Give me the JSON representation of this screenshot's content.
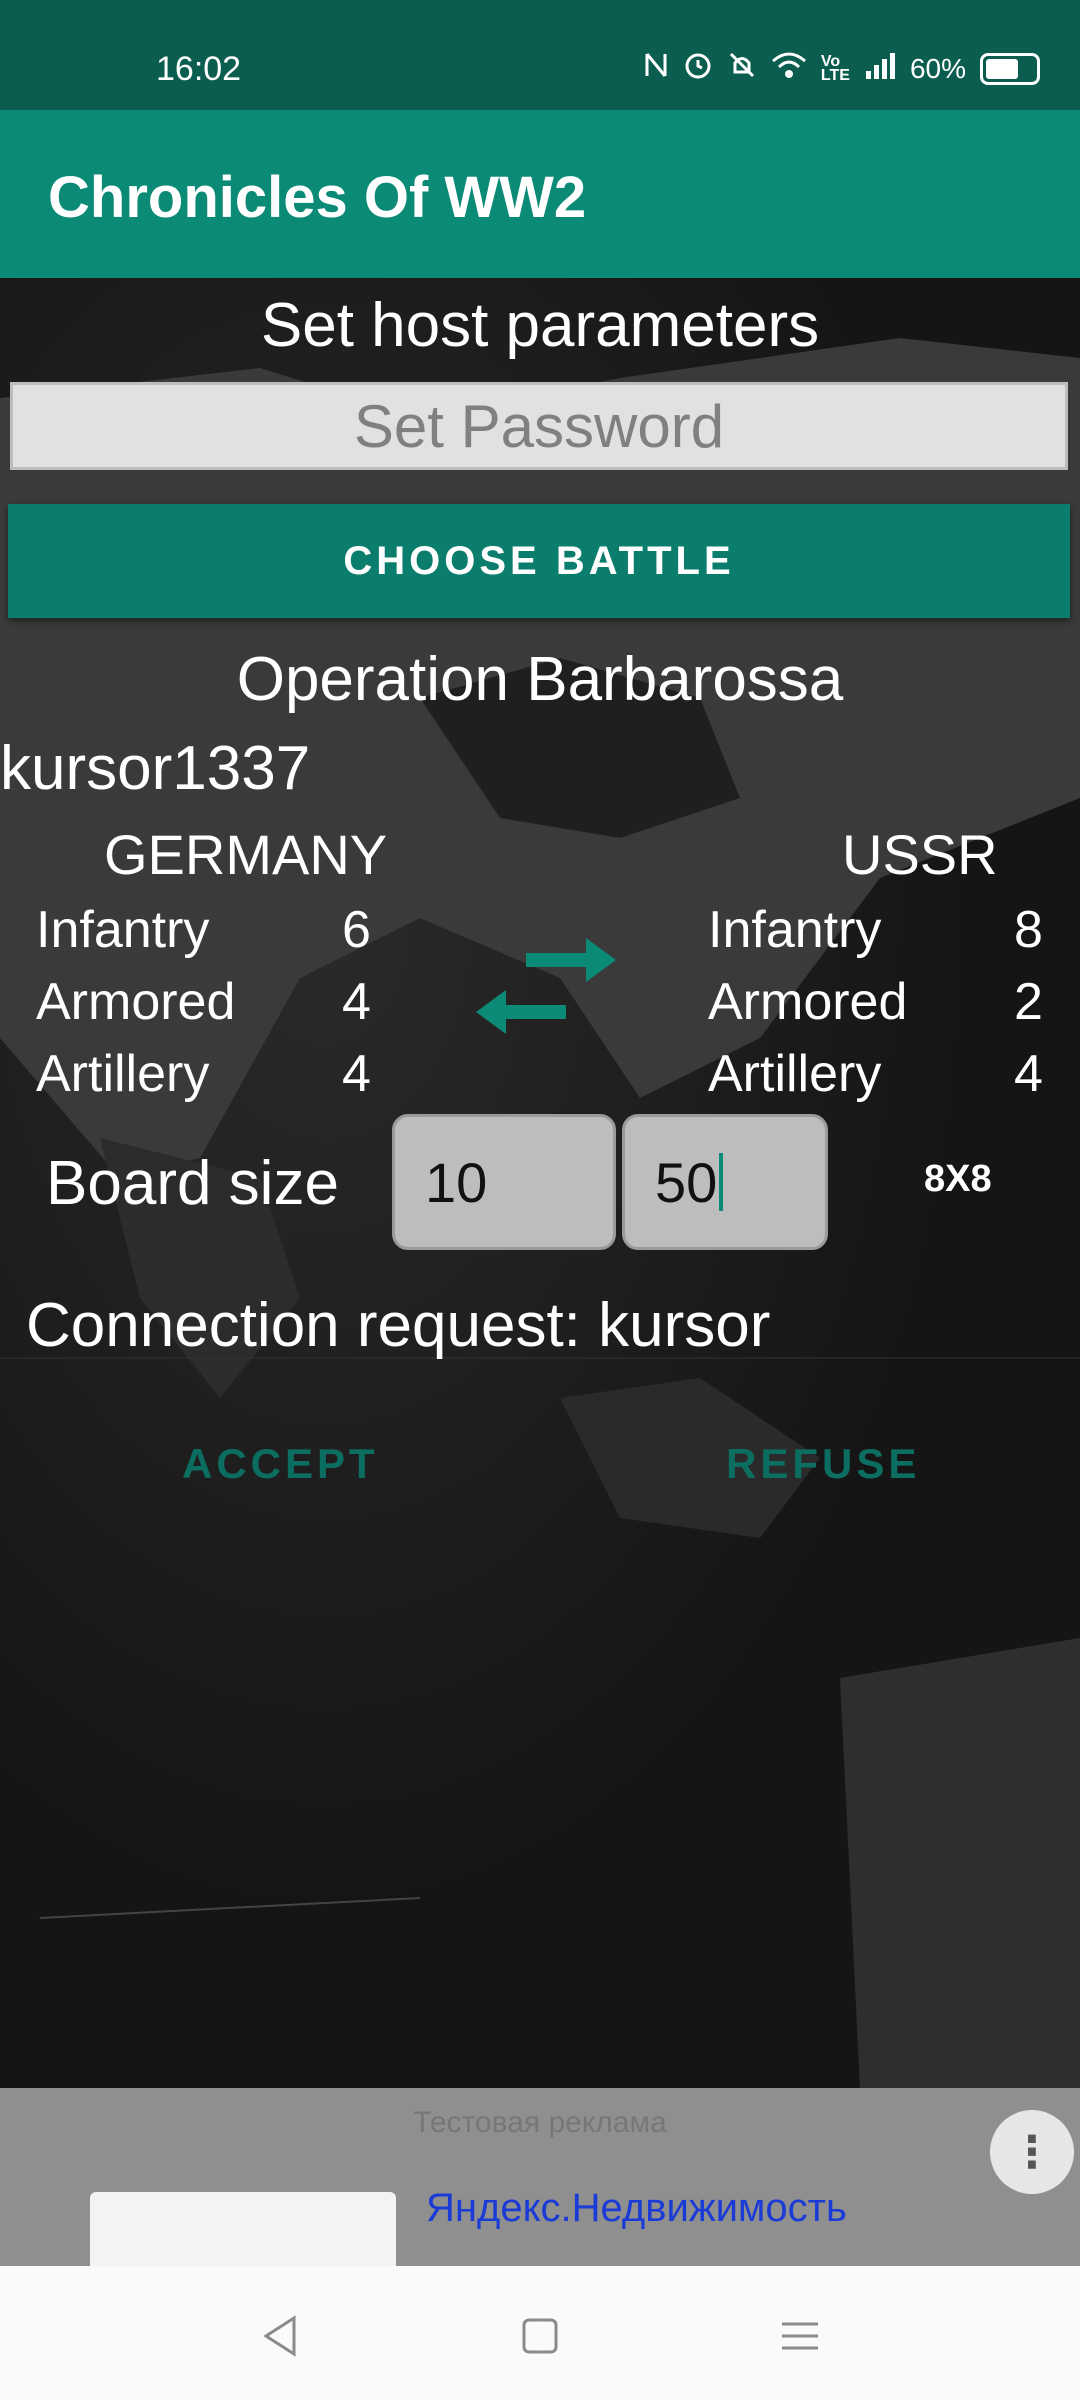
{
  "status_bar": {
    "time": "16:02",
    "battery": "60%",
    "icons": [
      "nfc-icon",
      "alarm-icon",
      "mute-icon",
      "wifi-icon",
      "volte-icon",
      "signal-icon",
      "battery-icon"
    ]
  },
  "app_bar": {
    "title": "Chronicles Of WW2"
  },
  "host": {
    "heading": "Set host parameters",
    "password_placeholder": "Set Password",
    "choose_battle_label": "CHOOSE BATTLE",
    "battle_name": "Operation Barbarossa",
    "host_name": "kursor1337"
  },
  "sides": {
    "left": {
      "name": "GERMANY",
      "units": [
        {
          "label": "Infantry",
          "value": "6"
        },
        {
          "label": "Armored",
          "value": "4"
        },
        {
          "label": "Artillery",
          "value": "4"
        }
      ]
    },
    "right": {
      "name": "USSR",
      "units": [
        {
          "label": "Infantry",
          "value": "8"
        },
        {
          "label": "Armored",
          "value": "2"
        },
        {
          "label": "Artillery",
          "value": "4"
        }
      ]
    },
    "swap_icon": "swap-arrows-icon"
  },
  "board": {
    "label": "Board size",
    "width_value": "10",
    "height_value": "50",
    "result": "8X8"
  },
  "connection": {
    "text": "Connection request: kursor",
    "accept_label": "ACCEPT",
    "refuse_label": "REFUSE"
  },
  "ad": {
    "label": "Тестовая реклама",
    "link_text": "Яндекс.Недвижимость"
  },
  "colors": {
    "status_bar": "#0b5e4f",
    "app_bar": "#0b8a76",
    "accent": "#0b7d6c"
  }
}
